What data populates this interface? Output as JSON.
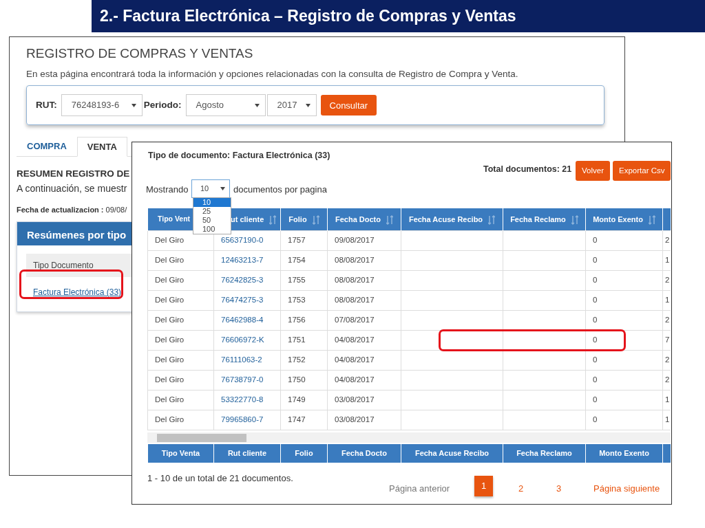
{
  "slide_title": "2.- Factura Electrónica – Registro de Compras y Ventas",
  "back_page": {
    "heading": "REGISTRO DE COMPRAS Y VENTAS",
    "intro": "En esta página encontrará toda la información y opciones relacionadas con la consulta de Registro de Compra y Venta.",
    "filters": {
      "rut_label": "RUT:",
      "rut": "76248193-6",
      "period_label": "Periodo:",
      "month": "Agosto",
      "year": "2017",
      "button": "Consultar"
    },
    "tabs": [
      {
        "label": "COMPRA",
        "selected": false
      },
      {
        "label": "VENTA",
        "selected": true
      }
    ],
    "summary_title": "RESUMEN REGISTRO DE",
    "summary_text": "A continuación, se muestr",
    "update_line": "**Fecha de actualizacion :** 09/08/",
    "panel": {
      "title": "Resúmenes por tipo",
      "column": "Tipo Documento",
      "link": "Factura Electrónica (33)"
    }
  },
  "detail": {
    "title": "Tipo de documento: Factura Electrónica (33)",
    "total": "Total documentos: 21",
    "buttons": [
      "Volver",
      "Exportar Csv"
    ],
    "showing_label": "Mostrando",
    "page_size": "10",
    "showing_suffix": "documentos por pagina",
    "page_size_options": [
      {
        "label": "10",
        "selected": true
      },
      {
        "label": "25",
        "selected": false
      },
      {
        "label": "50",
        "selected": false
      },
      {
        "label": "100",
        "selected": false
      }
    ],
    "header": [
      {
        "label": "Tipo Vent",
        "sortable": false
      },
      {
        "label": "ut cliente",
        "sortable": true
      },
      {
        "label": "Folio",
        "sortable": true
      },
      {
        "label": "Fecha Docto",
        "sortable": true
      },
      {
        "label": "Fecha Acuse Recibo",
        "sortable": true
      },
      {
        "label": "Fecha Reclamo",
        "sortable": true
      },
      {
        "label": "Monto Exento",
        "sortable": true
      }
    ],
    "rows": [
      [
        "Del Giro",
        "65637190-0",
        "1757",
        "09/08/2017",
        "",
        "",
        "0",
        "2"
      ],
      [
        "Del Giro",
        "12463213-7",
        "1754",
        "08/08/2017",
        "",
        "",
        "0",
        "1"
      ],
      [
        "Del Giro",
        "76242825-3",
        "1755",
        "08/08/2017",
        "",
        "",
        "0",
        "2"
      ],
      [
        "Del Giro",
        "76474275-3",
        "1753",
        "08/08/2017",
        "",
        "",
        "0",
        "1"
      ],
      [
        "Del Giro",
        "76462988-4",
        "1756",
        "07/08/2017",
        "",
        "",
        "0",
        "2"
      ],
      [
        "Del Giro",
        "76606972-K",
        "1751",
        "04/08/2017",
        "",
        "",
        "0",
        "7"
      ],
      [
        "Del Giro",
        "76111063-2",
        "1752",
        "04/08/2017",
        "",
        "",
        "0",
        "2"
      ],
      [
        "Del Giro",
        "76738797-0",
        "1750",
        "04/08/2017",
        "",
        "",
        "0",
        "2"
      ],
      [
        "Del Giro",
        "53322770-8",
        "1749",
        "03/08/2017",
        "",
        "",
        "0",
        "1"
      ],
      [
        "Del Giro",
        "79965860-7",
        "1747",
        "03/08/2017",
        "",
        "",
        "0",
        "1"
      ]
    ],
    "footer_header": [
      "Tipo Venta",
      "Rut cliente",
      "Folio",
      "Fecha Docto",
      "Fecha Acuse Recibo",
      "Fecha Reclamo",
      "Monto Exento"
    ],
    "summary": "1 - 10 de un total de 21 documentos.",
    "pagination": [
      {
        "label": "Página anterior",
        "kind": "prev",
        "selected": false,
        "disabled": true
      },
      {
        "label": "1",
        "kind": "page",
        "selected": true,
        "disabled": false
      },
      {
        "label": "2",
        "kind": "page",
        "selected": false,
        "disabled": false
      },
      {
        "label": "3",
        "kind": "page",
        "selected": false,
        "disabled": false
      },
      {
        "label": "Página siguiente",
        "kind": "next",
        "selected": false,
        "disabled": false
      }
    ]
  }
}
